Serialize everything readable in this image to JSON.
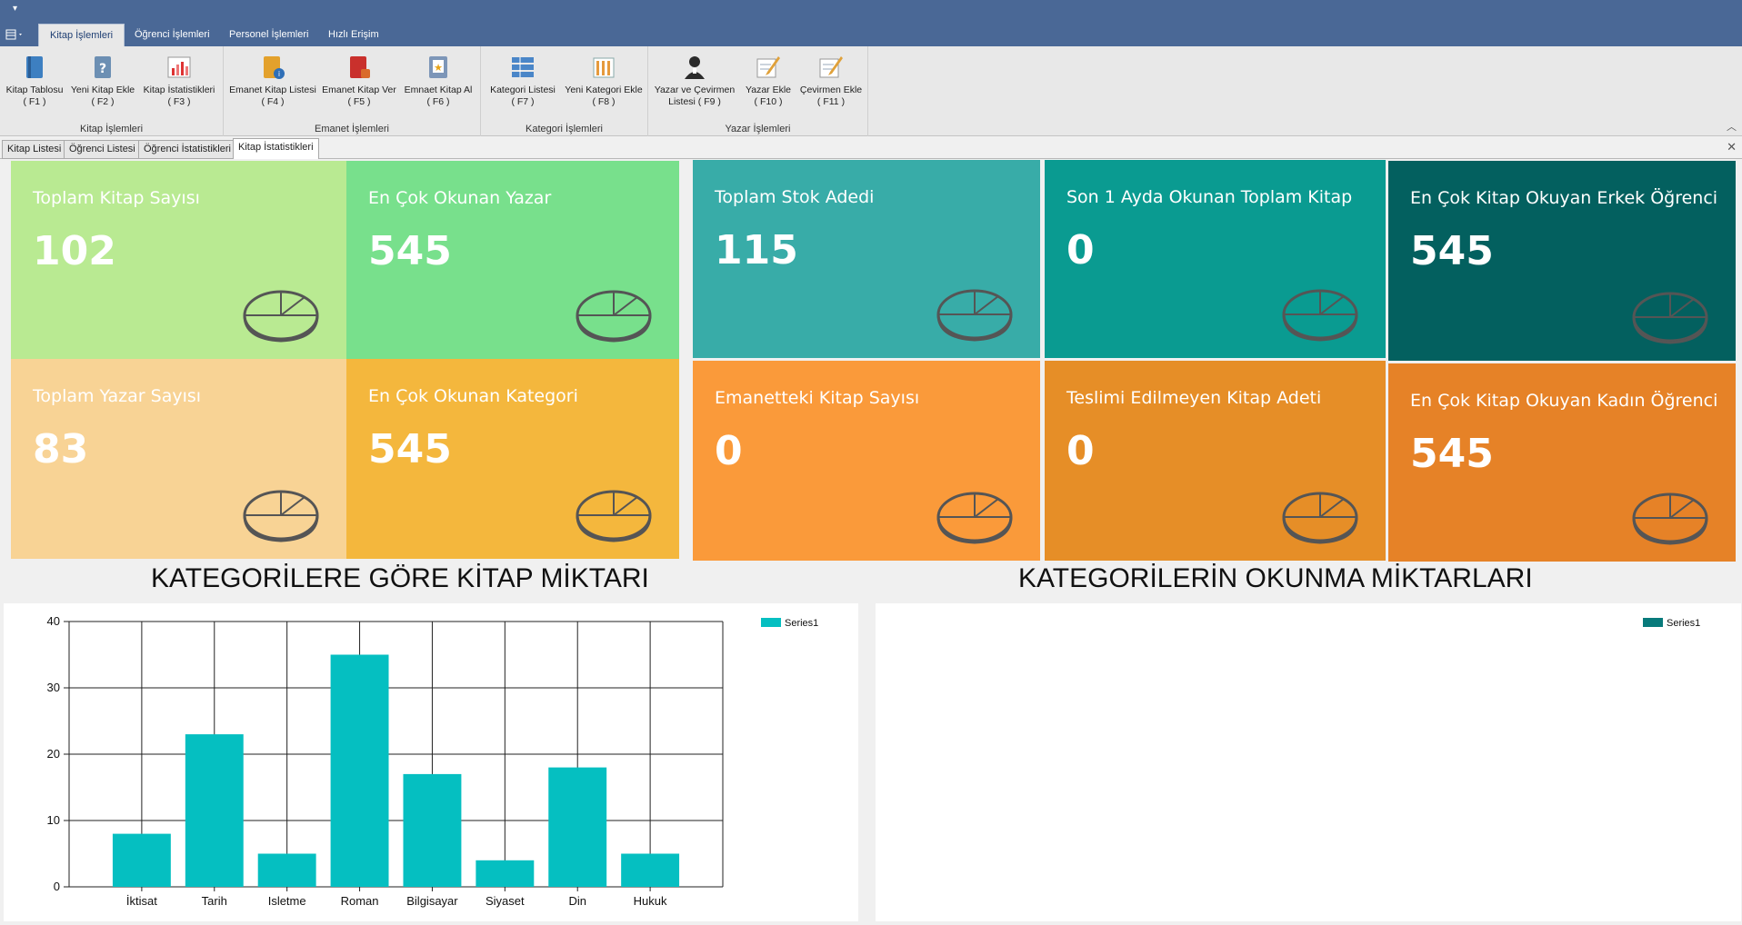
{
  "ribbon": {
    "tabs": [
      {
        "label": "Kitap İşlemleri",
        "active": true
      },
      {
        "label": "Öğrenci İşlemleri",
        "active": false
      },
      {
        "label": "Personel İşlemleri",
        "active": false
      },
      {
        "label": "Hızlı Erişim",
        "active": false
      }
    ],
    "groups": {
      "kitap": {
        "caption": "Kitap İşlemleri",
        "buttons": [
          {
            "label": "Kitap Tablosu",
            "key": "( F1 )",
            "icon": "book-icon"
          },
          {
            "label": "Yeni Kitap Ekle",
            "key": "( F2 )",
            "icon": "help-book-icon"
          },
          {
            "label": "Kitap İstatistikleri",
            "key": "( F3 )",
            "icon": "bar-chart-icon"
          }
        ]
      },
      "emanet": {
        "caption": "Emanet İşlemleri",
        "buttons": [
          {
            "label": "Emanet Kitap Listesi",
            "key": "( F4 )",
            "icon": "book-info-icon"
          },
          {
            "label": "Emanet Kitap Ver",
            "key": "( F5 )",
            "icon": "red-book-icon"
          },
          {
            "label": "Emnaet Kitap Al",
            "key": "( F6 )",
            "icon": "star-book-icon"
          }
        ]
      },
      "kategori": {
        "caption": "Kategori İşlemleri",
        "buttons": [
          {
            "label": "Kategori Listesi",
            "key": "( F7 )",
            "icon": "list-icon"
          },
          {
            "label": "Yeni Kategori Ekle",
            "key": "( F8 )",
            "icon": "columns-icon"
          }
        ]
      },
      "yazar": {
        "caption": "Yazar İşlemleri",
        "buttons": [
          {
            "label": "Yazar ve Çevirmen",
            "label2": "Listesi ( F9 )",
            "icon": "person-icon"
          },
          {
            "label": "Yazar Ekle",
            "key": "( F10 )",
            "icon": "pen-paper-icon"
          },
          {
            "label": "Çevirmen Ekle",
            "key": "( F11 )",
            "icon": "pen-paper-icon"
          }
        ]
      }
    }
  },
  "doc_tabs": [
    {
      "label": "Kitap Listesi",
      "active": false
    },
    {
      "label": "Öğrenci Listesi",
      "active": false
    },
    {
      "label": "Öğrenci İstatistikleri",
      "active": false
    },
    {
      "label": "Kitap İstatistikleri",
      "active": true
    }
  ],
  "tiles": [
    {
      "title": "Toplam Kitap Sayısı",
      "value": "102",
      "color": "#b9ea92"
    },
    {
      "title": "En Çok Okunan Yazar",
      "value": "545",
      "color": "#78e08c"
    },
    {
      "title": "Toplam Yazar Sayısı",
      "value": "83",
      "color": "#f8d395"
    },
    {
      "title": "En Çok Okunan Kategori",
      "value": "545",
      "color": "#f4b73d"
    },
    {
      "title": "Toplam Stok Adedi",
      "value": "115",
      "color": "#38aca8"
    },
    {
      "title": "Son 1 Ayda Okunan Toplam Kitap",
      "value": "0",
      "color": "#0a9b91"
    },
    {
      "title": "En Çok Kitap Okuyan Erkek Öğrenci",
      "value": "545",
      "color": "#03605f"
    },
    {
      "title": "Emanetteki Kitap Sayısı",
      "value": "0",
      "color": "#fa9a3a"
    },
    {
      "title": "Teslimi Edilmeyen Kitap Adeti",
      "value": "0",
      "color": "#e68e27"
    },
    {
      "title": "En Çok Kitap Okuyan Kadın Öğrenci",
      "value": "545",
      "color": "#e68227"
    }
  ],
  "sections": {
    "left_title": "KATEGORİLERE GÖRE KİTAP MİKTARI",
    "right_title": "KATEGORİLERİN OKUNMA MİKTARLARI"
  },
  "chart_data": [
    {
      "type": "bar",
      "categories": [
        "İktisat",
        "Tarih",
        "Isletme",
        "Roman",
        "Bilgisayar",
        "Siyaset",
        "Din",
        "Hukuk"
      ],
      "series": [
        {
          "name": "Series1",
          "values": [
            8,
            23,
            5,
            35,
            17,
            4,
            18,
            5
          ],
          "color": "#05bfc1"
        }
      ],
      "ylim": [
        0,
        40
      ],
      "yticks": [
        0,
        10,
        20,
        30,
        40
      ],
      "grid": true,
      "legend": "top-right"
    },
    {
      "type": "pie",
      "series": [
        {
          "name": "Series1",
          "values": [],
          "color": "#087a7b"
        }
      ],
      "legend": "top-right"
    }
  ]
}
